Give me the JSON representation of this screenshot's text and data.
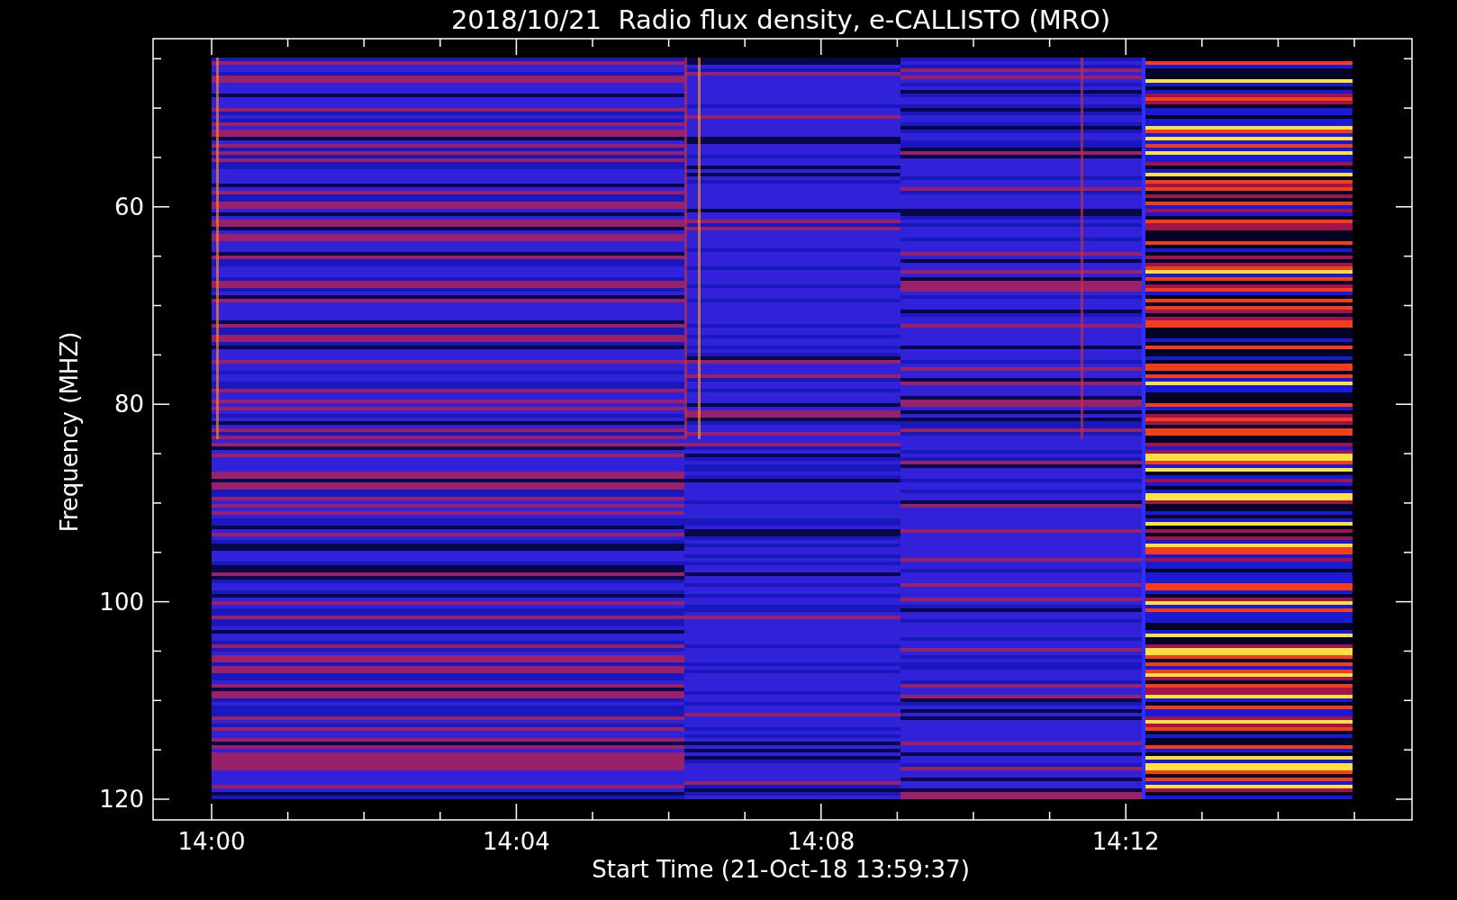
{
  "title": "2018/10/21  Radio flux density, e-CALLISTO (MRO)",
  "x_axis": {
    "label": "Start Time (21-Oct-18 13:59:37)",
    "ticks": [
      "14:00",
      "14:04",
      "14:08",
      "14:12"
    ]
  },
  "y_axis": {
    "label": "Frequency (MHZ)",
    "ticks": [
      "60",
      "80",
      "100",
      "120"
    ]
  }
}
